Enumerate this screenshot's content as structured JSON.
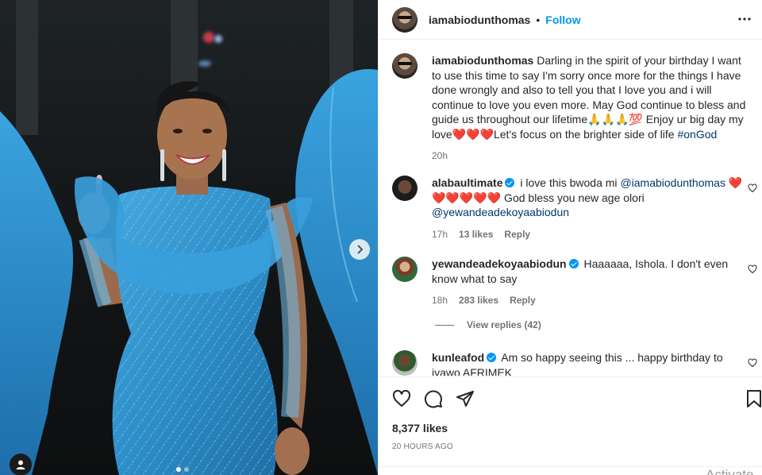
{
  "post": {
    "username": "iamabiodunthomas",
    "separator": "•",
    "follow_label": "Follow",
    "more_icon": "more-horizontal-icon"
  },
  "caption": {
    "username": "iamabiodunthomas",
    "text_1": " Darling in the spirit of your birthday I want to use this time to say I'm sorry once more for the things I have done wrongly and also to tell you that I love you and i will continue to love you even more. May God continue to bless and guide us throughout our lifetime🙏🙏🙏💯 Enjoy ur big day my love",
    "hearts": "❤️❤️❤️",
    "text_2": "Let's focus on the brighter side of life ",
    "hashtag": "#onGod",
    "time": "20h"
  },
  "comments": [
    {
      "username": "alabaultimate",
      "text_1": " i love this bwoda mi ",
      "mention_1": "@iamabiodunthomas",
      "hearts": " ❤️ ❤️❤️❤️❤️❤️",
      "text_2": " God bless you new age olori ",
      "mention_2": "@yewandeadekoyaabiodun",
      "time": "17h",
      "likes": "13 likes",
      "reply": "Reply"
    },
    {
      "username": "yewandeadekoyaabiodun",
      "text": " Haaaaaa, Ishola. I don't even know what to say",
      "time": "18h",
      "likes": "283 likes",
      "reply": "Reply",
      "view_replies": "View replies (42)"
    },
    {
      "username": "kunleafod",
      "text": " Am so happy seeing this ... happy birthday to iyawo AFRIMEK"
    }
  ],
  "footer": {
    "likes": "8,377 likes",
    "time_ago": "20 HOURS AGO",
    "watermark": "Activate"
  },
  "colors": {
    "accent": "#0095f6",
    "text": "#262626",
    "muted": "#737373",
    "link": "#00376b",
    "dress": "#2f8fc9"
  }
}
